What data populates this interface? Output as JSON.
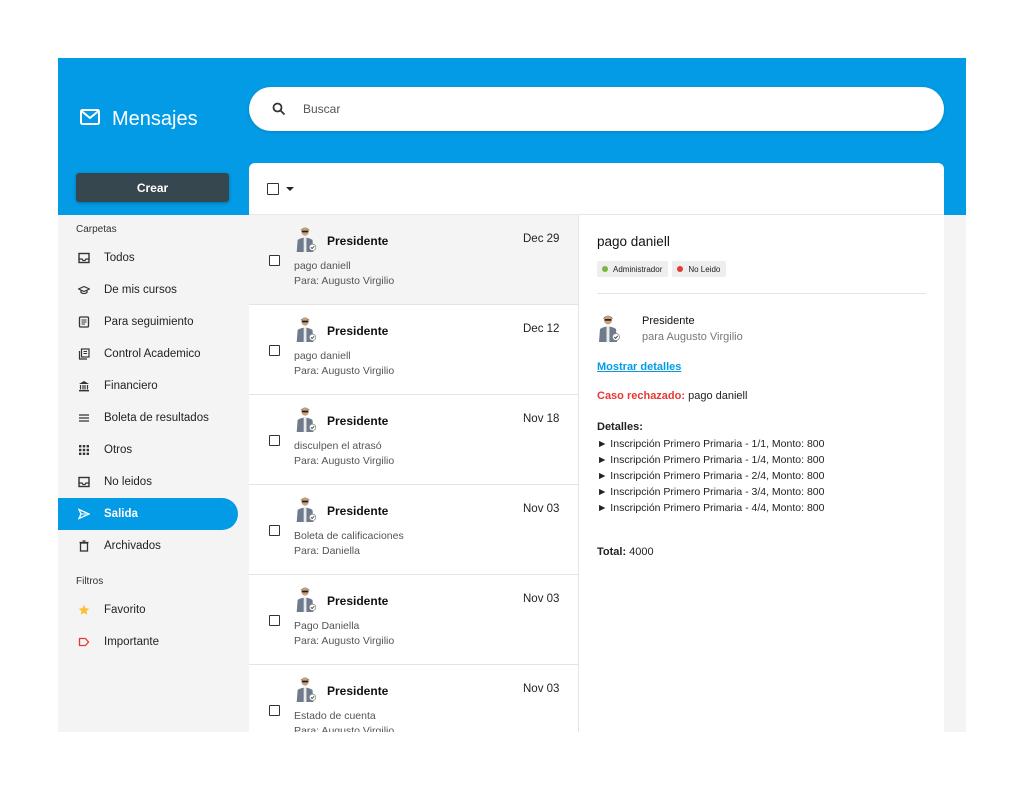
{
  "app": {
    "title": "Mensajes",
    "search_placeholder": "Buscar",
    "create_label": "Crear",
    "accent": "#039be5"
  },
  "sidebar": {
    "folders_label": "Carpetas",
    "folders": [
      {
        "label": "Todos",
        "icon": "inbox-icon"
      },
      {
        "label": "De mis cursos",
        "icon": "graduation-cap-icon"
      },
      {
        "label": "Para seguimiento",
        "icon": "document-icon"
      },
      {
        "label": "Control Academico",
        "icon": "library-icon"
      },
      {
        "label": "Financiero",
        "icon": "bank-icon"
      },
      {
        "label": "Boleta de resultados",
        "icon": "list-icon"
      },
      {
        "label": "Otros",
        "icon": "grid-icon"
      },
      {
        "label": "No leidos",
        "icon": "inbox-icon"
      },
      {
        "label": "Salida",
        "icon": "send-icon",
        "active": true
      },
      {
        "label": "Archivados",
        "icon": "trash-icon"
      }
    ],
    "filters_label": "Filtros",
    "filters": [
      {
        "label": "Favorito",
        "icon": "star-icon",
        "color": "#fbc02d"
      },
      {
        "label": "Importante",
        "icon": "label-icon",
        "color": "#e53935"
      }
    ]
  },
  "messages": [
    {
      "sender": "Presidente",
      "date": "Dec 29",
      "subject": "pago daniell",
      "to": "Para: Augusto Virgilio",
      "selected": true
    },
    {
      "sender": "Presidente",
      "date": "Dec 12",
      "subject": "pago daniell",
      "to": "Para: Augusto Virgilio"
    },
    {
      "sender": "Presidente",
      "date": "Nov 18",
      "subject": "disculpen el atrasó",
      "to": "Para: Augusto Virgilio"
    },
    {
      "sender": "Presidente",
      "date": "Nov 03",
      "subject": "Boleta de calificaciones",
      "to": "Para: Daniella"
    },
    {
      "sender": "Presidente",
      "date": "Nov 03",
      "subject": "Pago Daniella",
      "to": "Para: Augusto Virgilio"
    },
    {
      "sender": "Presidente",
      "date": "Nov 03",
      "subject": "Estado de cuenta",
      "to": "Para: Augusto Virgilio"
    }
  ],
  "detail": {
    "subject": "pago daniell",
    "tags": [
      {
        "label": "Administrador",
        "color": "#7cb342"
      },
      {
        "label": "No Leido",
        "color": "#e53935"
      }
    ],
    "sender": "Presidente",
    "recipient": "para Augusto Virgilio",
    "show_details": "Mostrar detalles",
    "case_label": "Caso rechazado:",
    "case_text": " pago daniell",
    "details_title": "Detalles:",
    "items": [
      "► Inscripción Primero Primaria - 1/1, Monto: 800",
      "► Inscripción Primero Primaria - 1/4, Monto: 800",
      "► Inscripción Primero Primaria - 2/4, Monto: 800",
      "► Inscripción Primero Primaria - 3/4, Monto: 800",
      "► Inscripción Primero Primaria - 4/4, Monto: 800"
    ],
    "total_label": "Total:",
    "total_value": " 4000"
  }
}
